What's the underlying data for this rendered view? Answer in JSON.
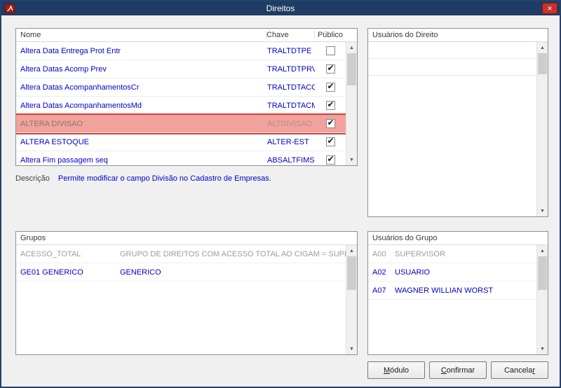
{
  "window": {
    "title": "Direitos",
    "close": "✕"
  },
  "icons": {
    "up": "▲",
    "down": "▼"
  },
  "rights": {
    "columns": {
      "nome": "Nome",
      "chave": "Chave",
      "publico": "Público"
    },
    "rows": [
      {
        "nome": "Altera Data Entrega Prot Entr",
        "chave": "TRALTDTPE",
        "publico": false,
        "selected": false
      },
      {
        "nome": "Altera Datas Acomp Prev",
        "chave": "TRALTDTPRV",
        "publico": true,
        "selected": false
      },
      {
        "nome": "Altera Datas AcompanhamentosCr",
        "chave": "TRALTDTACO",
        "publico": true,
        "selected": false
      },
      {
        "nome": "Altera Datas AcompanhamentosMd",
        "chave": "TRALTDTACM",
        "publico": true,
        "selected": false
      },
      {
        "nome": "ALTERA DIVISAO",
        "chave": "ALTDIVISAO",
        "publico": true,
        "selected": true
      },
      {
        "nome": "ALTERA ESTOQUE",
        "chave": "ALTER-EST",
        "publico": true,
        "selected": false
      },
      {
        "nome": "Altera Fim passagem seq",
        "chave": "ABSALTFIMS",
        "publico": true,
        "selected": false
      }
    ]
  },
  "descricao": {
    "label": "Descrição",
    "text": "Permite modificar o campo Divisão no Cadastro de Empresas."
  },
  "usuarios_direito": {
    "title": "Usuários do Direito"
  },
  "grupos": {
    "title": "Grupos",
    "rows": [
      {
        "codigo": "ACESSO_TOTAL",
        "descricao": "GRUPO DE DIREITOS COM ACESSO TOTAL AO CIGAM = SUPERVISOR - ("
      },
      {
        "codigo": "GE01 GENERICO",
        "descricao": "GENERICO"
      }
    ]
  },
  "usuarios_grupo": {
    "title": "Usuários do Grupo",
    "rows": [
      {
        "codigo": "A00",
        "nome": "SUPERVISOR"
      },
      {
        "codigo": "A02",
        "nome": "USUARIO"
      },
      {
        "codigo": "A07",
        "nome": "WAGNER WILLIAN WORST"
      }
    ]
  },
  "buttons": [
    {
      "id": "modulo",
      "pre": "",
      "key": "M",
      "post": "ódulo"
    },
    {
      "id": "confirmar",
      "pre": "",
      "key": "C",
      "post": "onfirmar"
    },
    {
      "id": "cancelar",
      "pre": "Cancela",
      "key": "r",
      "post": ""
    }
  ],
  "colors": {
    "titlebar": "#1e3c64",
    "selection_bg": "#f2a29c",
    "selection_border": "#d4403a",
    "link": "#0000c8",
    "muted": "#9b9b9b"
  }
}
